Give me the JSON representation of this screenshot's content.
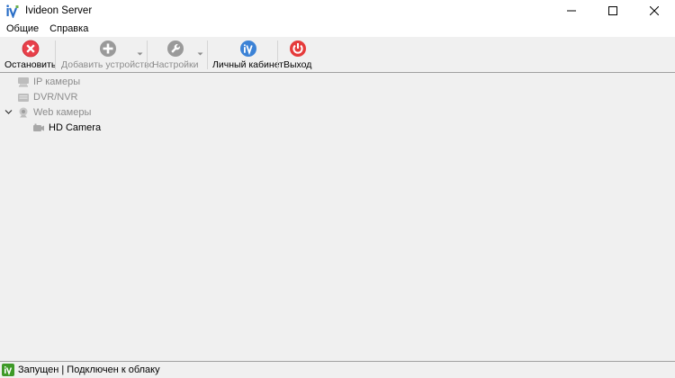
{
  "window": {
    "title": "Ivideon Server"
  },
  "menu": {
    "items": [
      "Общие",
      "Справка"
    ]
  },
  "toolbar": {
    "stop_label": "Остановить",
    "add_device_label": "Добавить устройство",
    "settings_label": "Настройки",
    "account_label": "Личный кабинет",
    "exit_label": "Выход"
  },
  "tree": {
    "ip_cameras": "IP камеры",
    "dvr_nvr": "DVR/NVR",
    "web_cameras": "Web камеры",
    "hd_camera": "HD Camera"
  },
  "status": {
    "text": "Запущен | Подключен к облаку"
  },
  "colors": {
    "stop_red": "#e8404a",
    "exit_red": "#e53a3a",
    "account_blue": "#3b82d6",
    "status_green": "#3e9a28",
    "disabled_gray": "#8c8c8c"
  },
  "icons": {
    "stop": "stop-icon",
    "add_device": "plus-icon",
    "settings": "wrench-icon",
    "account": "ivideon-icon",
    "exit": "power-icon"
  }
}
